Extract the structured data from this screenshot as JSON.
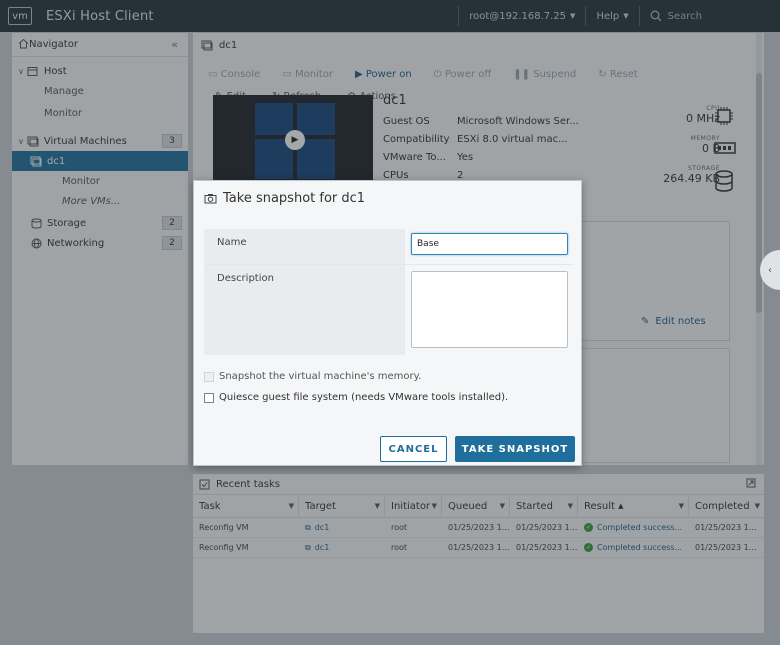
{
  "header": {
    "logo": "vm",
    "app_title": "ESXi Host Client",
    "user": "root@192.168.7.25",
    "help": "Help",
    "search_placeholder": "Search"
  },
  "navigator": {
    "title": "Navigator",
    "host": "Host",
    "manage": "Manage",
    "monitor": "Monitor",
    "virtual_machines": "Virtual Machines",
    "vm_count": "3",
    "vm_selected": "dc1",
    "vm_monitor": "Monitor",
    "more_vms": "More VMs...",
    "storage": "Storage",
    "storage_count": "2",
    "networking": "Networking",
    "networking_count": "2"
  },
  "main": {
    "title": "dc1",
    "toolbar": {
      "console": "Console",
      "monitor": "Monitor",
      "power_on": "Power on",
      "power_off": "Power off",
      "suspend": "Suspend",
      "reset": "Reset",
      "edit": "Edit",
      "refresh": "Refresh",
      "actions": "Actions"
    },
    "vm_name": "dc1",
    "info": [
      {
        "key": "Guest OS",
        "value": "Microsoft Windows Ser..."
      },
      {
        "key": "Compatibility",
        "value": "ESXi 8.0 virtual mac..."
      },
      {
        "key": "VMware To...",
        "value": "Yes"
      },
      {
        "key": "CPUs",
        "value": "2"
      }
    ],
    "resources": {
      "cpu_label": "CPU",
      "cpu_value": "0 MHz",
      "memory_label": "MEMORY",
      "memory_value": "0 B",
      "storage_label": "STORAGE",
      "storage_value": "264.49 KB"
    },
    "edit_notes": "Edit notes"
  },
  "tasks": {
    "title": "Recent tasks",
    "columns": [
      "Task",
      "Target",
      "Initiator",
      "Queued",
      "Started",
      "Result",
      "Completed"
    ],
    "rows": [
      {
        "task": "Reconfig VM",
        "target": "dc1",
        "initiator": "root",
        "queued": "01/25/2023 1...",
        "started": "01/25/2023 1...",
        "result": "Completed success...",
        "completed": "01/25/2023 1..."
      },
      {
        "task": "Reconfig VM",
        "target": "dc1",
        "initiator": "root",
        "queued": "01/25/2023 1...",
        "started": "01/25/2023 1...",
        "result": "Completed success...",
        "completed": "01/25/2023 1..."
      }
    ]
  },
  "dialog": {
    "title": "Take snapshot for dc1",
    "name_label": "Name",
    "name_value": "Base",
    "description_label": "Description",
    "description_value": "",
    "memory_option": "Snapshot the virtual machine's memory.",
    "quiesce_option": "Quiesce guest file system (needs VMware tools installed).",
    "cancel_label": "CANCEL",
    "take_label": "TAKE SNAPSHOT"
  },
  "colors": {
    "accent": "#1f6e9c",
    "header_bg": "#27323a",
    "success": "#3a9c3a"
  }
}
